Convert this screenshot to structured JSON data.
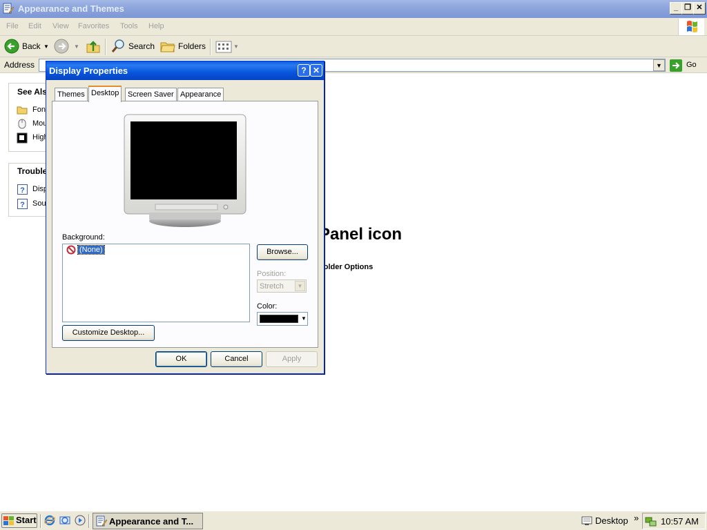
{
  "window": {
    "title": "Appearance and Themes",
    "controls": [
      "_",
      "❐",
      "✕"
    ]
  },
  "menubar": {
    "items": [
      "File",
      "Edit",
      "View",
      "Favorites",
      "Tools",
      "Help"
    ]
  },
  "toolbar": {
    "back_label": "Back",
    "search_label": "Search",
    "folders_label": "Folders"
  },
  "addressbar": {
    "label": "Address",
    "go_label": "Go"
  },
  "left_pane": {
    "see_also_heading": "See Also",
    "see_also_items": [
      "Fonts",
      "Mouse Pointers",
      "High Contrast"
    ],
    "troubleshooters_heading": "Troubleshooters",
    "troubleshooters_items": [
      "Display",
      "Sound"
    ]
  },
  "content": {
    "heading": "Panel icon",
    "link": "Folder Options"
  },
  "dialog": {
    "title": "Display Properties",
    "help_btn": "?",
    "close_btn": "✕",
    "tabs": [
      "Themes",
      "Desktop",
      "Screen Saver",
      "Appearance"
    ],
    "active_tab": "Desktop",
    "background_label": "Background:",
    "background_items": [
      "(None)"
    ],
    "browse_label": "Browse...",
    "position_label": "Position:",
    "position_value": "Stretch",
    "color_label": "Color:",
    "color_value": "#000000",
    "customize_label": "Customize Desktop...",
    "ok_label": "OK",
    "cancel_label": "Cancel",
    "apply_label": "Apply"
  },
  "taskbar": {
    "start_label": "Start",
    "task_label": "Appearance and T...",
    "desktop_label": "Desktop",
    "chevron": "»",
    "clock": "10:57 AM"
  }
}
